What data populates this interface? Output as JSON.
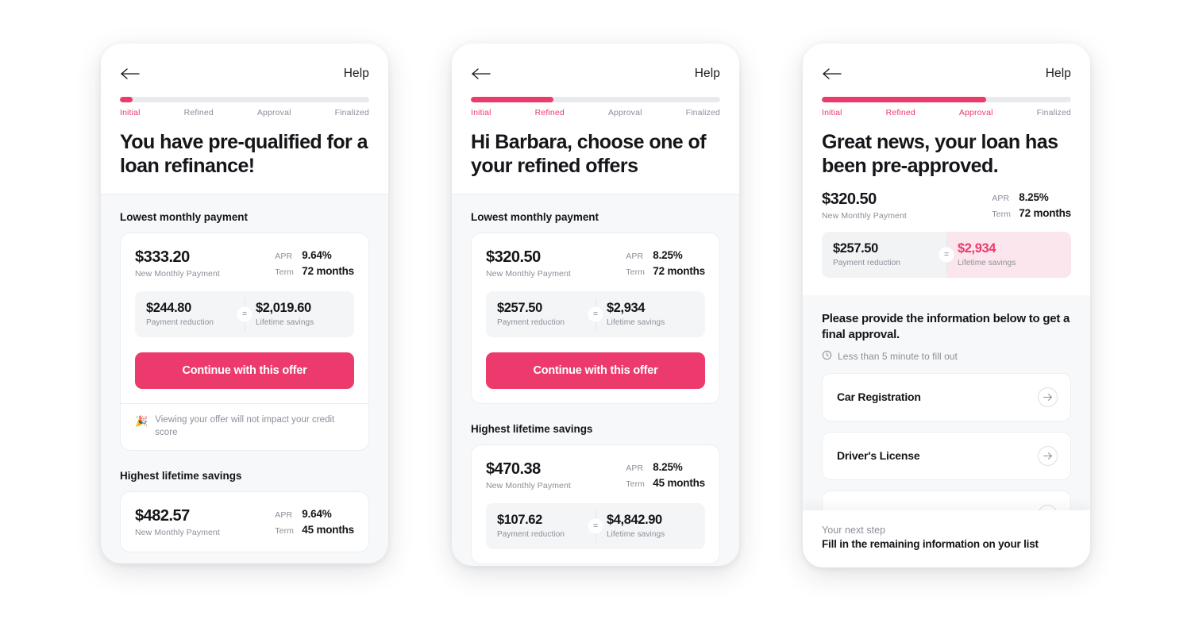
{
  "brand": {
    "pink": "#ec3a6d",
    "pink_soft": "#fce6ed",
    "grey_track": "#e9eaee"
  },
  "common": {
    "help_label": "Help",
    "back_icon": "back-arrow-icon",
    "steps": [
      "Initial",
      "Refined",
      "Approval",
      "Finalized"
    ],
    "labels": {
      "new_monthly_payment": "New Monthly Payment",
      "apr": "APR",
      "term": "Term",
      "payment_reduction": "Payment reduction",
      "lifetime_savings": "Lifetime savings",
      "equals": "="
    },
    "cta_label": "Continue with this offer",
    "section_lowest": "Lowest monthly payment",
    "section_highest": "Highest lifetime savings"
  },
  "screen1": {
    "progress_percent": 5,
    "active_steps": 1,
    "headline": "You have pre-qualified for a loan refinance!",
    "offers": [
      {
        "section": "Lowest monthly payment",
        "payment": "$333.20",
        "apr": "9.64%",
        "term": "72 months",
        "reduction": "$244.80",
        "savings": "$2,019.60",
        "note_icon": "party-popper-icon",
        "note": "Viewing your offer will not impact your credit score"
      },
      {
        "section": "Highest lifetime savings",
        "payment": "$482.57",
        "apr": "9.64%",
        "term": "45 months"
      }
    ]
  },
  "screen2": {
    "progress_percent": 33,
    "active_steps": 2,
    "headline": "Hi Barbara, choose one of your refined offers",
    "offers": [
      {
        "section": "Lowest monthly payment",
        "payment": "$320.50",
        "apr": "8.25%",
        "term": "72 months",
        "reduction": "$257.50",
        "savings": "$2,934"
      },
      {
        "section": "Highest lifetime savings",
        "payment": "$470.38",
        "apr": "8.25%",
        "term": "45 months",
        "reduction": "$107.62",
        "savings": "$4,842.90"
      }
    ]
  },
  "screen3": {
    "progress_percent": 66,
    "active_steps": 3,
    "headline": "Great news, your loan has been pre-approved.",
    "summary": {
      "payment": "$320.50",
      "apr": "8.25%",
      "term": "72 months",
      "reduction": "$257.50",
      "savings": "$2,934"
    },
    "instruction": "Please provide the information below to get a final approval.",
    "time_icon": "clock-icon",
    "time_note": "Less than 5 minute to fill out",
    "documents": [
      {
        "label": "Car Registration",
        "arrow_icon": "arrow-right-icon"
      },
      {
        "label": "Driver's License",
        "arrow_icon": "arrow-right-icon"
      }
    ],
    "footer": {
      "eyebrow": "Your next step",
      "text": "Fill in the remaining information on your list"
    }
  }
}
